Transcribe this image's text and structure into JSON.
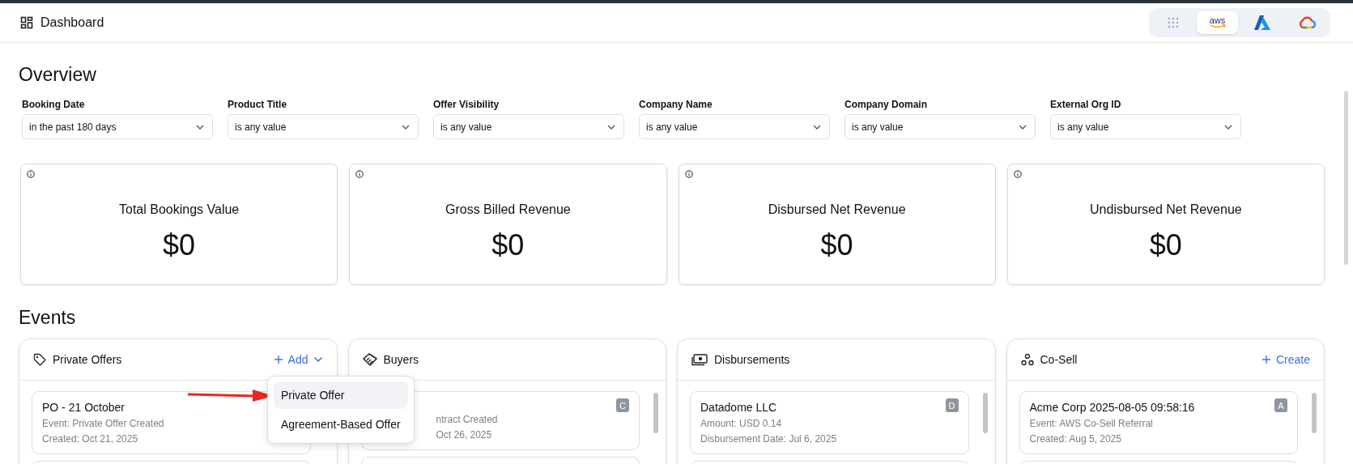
{
  "header": {
    "title": "Dashboard"
  },
  "providers": [
    {
      "kind": "apps",
      "selected": false
    },
    {
      "kind": "aws",
      "label": "aws",
      "selected": true
    },
    {
      "kind": "azure",
      "selected": false
    },
    {
      "kind": "gcloud",
      "selected": false
    }
  ],
  "overview": {
    "heading": "Overview",
    "filters": [
      {
        "label": "Booking Date",
        "value": "in the past 180 days"
      },
      {
        "label": "Product Title",
        "value": "is any value"
      },
      {
        "label": "Offer Visibility",
        "value": "is any value"
      },
      {
        "label": "Company Name",
        "value": "is any value"
      },
      {
        "label": "Company Domain",
        "value": "is any value"
      },
      {
        "label": "External Org ID",
        "value": "is any value"
      }
    ],
    "metrics": [
      {
        "title": "Total Bookings Value",
        "value": "$0"
      },
      {
        "title": "Gross Billed Revenue",
        "value": "$0"
      },
      {
        "title": "Disbursed Net Revenue",
        "value": "$0"
      },
      {
        "title": "Undisbursed Net Revenue",
        "value": "$0"
      }
    ]
  },
  "events": {
    "heading": "Events",
    "panels": [
      {
        "kind": "tag",
        "title": "Private Offers",
        "action": {
          "label": "Add",
          "caret": true
        },
        "cards": [
          {
            "title": "PO - 21 October",
            "lines": [
              "Event: Private Offer Created",
              "Created: Oct 21, 2025"
            ]
          }
        ]
      },
      {
        "kind": "handshake",
        "title": "Buyers",
        "cards": [
          {
            "badge": "C",
            "lines": [
              "ntract Created",
              "Oct 26, 2025"
            ]
          }
        ]
      },
      {
        "kind": "money",
        "title": "Disbursements",
        "cards": [
          {
            "title": "Datadome LLC",
            "badge": "D",
            "lines": [
              "Amount: USD 0.14",
              "Disbursement Date: Jul 6, 2025"
            ]
          }
        ]
      },
      {
        "kind": "cosell",
        "title": "Co-Sell",
        "action": {
          "label": "Create",
          "caret": false
        },
        "cards": [
          {
            "title": "Acme Corp 2025-08-05 09:58:16",
            "badge": "A",
            "lines": [
              "Event: AWS Co-Sell Referral",
              "Created: Aug 5, 2025"
            ]
          }
        ]
      }
    ],
    "menu": [
      {
        "label": "Private Offer",
        "selected": true
      },
      {
        "label": "Agreement-Based Offer",
        "selected": false
      }
    ]
  }
}
